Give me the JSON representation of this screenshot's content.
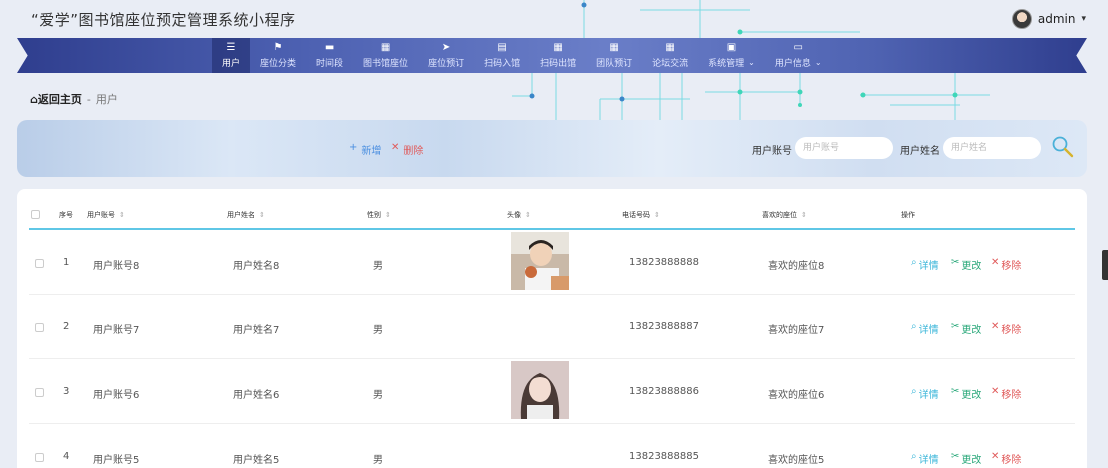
{
  "app": {
    "title": "“爱学”图书馆座位预定管理系统小程序"
  },
  "user": {
    "name": "admin",
    "caret": "▾"
  },
  "nav": {
    "items": [
      {
        "label": "用户",
        "icon": "list-icon",
        "glyph": "☰"
      },
      {
        "label": "座位分类",
        "icon": "flag-icon",
        "glyph": "⚑"
      },
      {
        "label": "时间段",
        "icon": "briefcase-icon",
        "glyph": "▬"
      },
      {
        "label": "图书馆座位",
        "icon": "grid-icon",
        "glyph": "▦"
      },
      {
        "label": "座位预订",
        "icon": "send-icon",
        "glyph": "➤"
      },
      {
        "label": "扫码入馆",
        "icon": "clipboard-icon",
        "glyph": "▤"
      },
      {
        "label": "扫码出馆",
        "icon": "grid-icon",
        "glyph": "▦"
      },
      {
        "label": "团队预订",
        "icon": "grid-icon",
        "glyph": "▦"
      },
      {
        "label": "论坛交流",
        "icon": "grid-icon",
        "glyph": "▦"
      },
      {
        "label": "系统管理",
        "icon": "clipboard-check-icon",
        "glyph": "▣",
        "dropdown": "⌄"
      },
      {
        "label": "用户信息",
        "icon": "window-icon",
        "glyph": "▭",
        "dropdown": "⌄"
      }
    ]
  },
  "breadcrumb": {
    "home_icon": "⌂",
    "home": "返回主页",
    "sep": "-",
    "current": "用户"
  },
  "toolbar": {
    "add_icon": "+",
    "add_label": "新增",
    "delete_icon": "✕",
    "delete_label": "删除",
    "account_label": "用户账号",
    "account_placeholder": "用户账号",
    "name_label": "用户姓名",
    "name_placeholder": "用户姓名"
  },
  "table": {
    "headers": {
      "index": "序号",
      "account": "用户账号",
      "name": "用户姓名",
      "gender": "性别",
      "photo": "头像",
      "phone": "电话号码",
      "seat": "喜欢的座位",
      "actions": "操作"
    },
    "sort_glyph": "⇕",
    "action_labels": {
      "detail": "详情",
      "edit": "更改",
      "remove": "移除"
    },
    "action_glyphs": {
      "detail": "⌕",
      "edit": "✂",
      "remove": "✕"
    },
    "rows": [
      {
        "index": "1",
        "account": "用户账号8",
        "name": "用户姓名8",
        "gender": "男",
        "phone": "13823888888",
        "seat": "喜欢的座位8",
        "has_photo": true
      },
      {
        "index": "2",
        "account": "用户账号7",
        "name": "用户姓名7",
        "gender": "男",
        "phone": "13823888887",
        "seat": "喜欢的座位7",
        "has_photo": false
      },
      {
        "index": "3",
        "account": "用户账号6",
        "name": "用户姓名6",
        "gender": "男",
        "phone": "13823888886",
        "seat": "喜欢的座位6",
        "has_photo": true
      },
      {
        "index": "4",
        "account": "用户账号5",
        "name": "用户姓名5",
        "gender": "男",
        "phone": "13823888885",
        "seat": "喜欢的座位5",
        "has_photo": false
      }
    ]
  },
  "colors": {
    "nav_dark": "#2f3e8e",
    "accent_line": "#5fc7e6",
    "detail": "#3bb6d9",
    "edit": "#2aa87a",
    "remove": "#e05a5a"
  }
}
